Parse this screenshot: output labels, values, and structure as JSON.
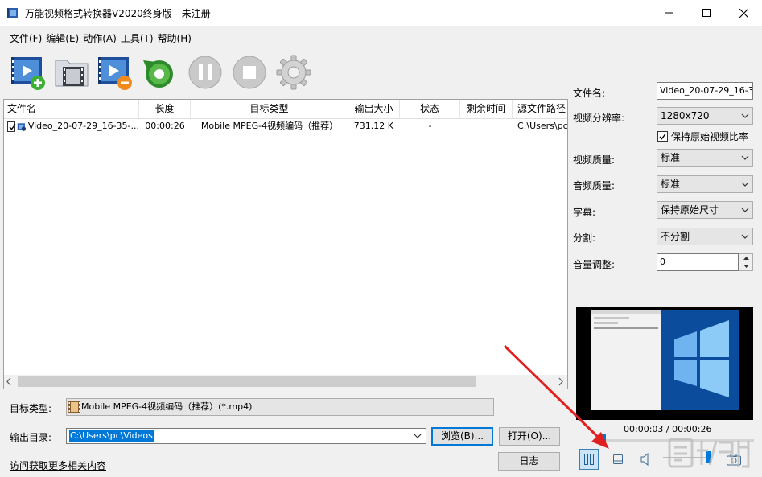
{
  "window": {
    "title": "万能视频格式转换器V2020终身版 - 未注册",
    "controls": [
      "minimize-icon",
      "maximize-icon",
      "close-icon"
    ]
  },
  "menu": [
    "文件(F)",
    "编辑(E)",
    "动作(A)",
    "工具(T)",
    "帮助(H)"
  ],
  "toolbar": {
    "buttons": [
      "add-video-icon",
      "add-folder-icon",
      "remove-video-icon",
      "convert-icon",
      "pause-icon",
      "stop-icon",
      "settings-icon"
    ]
  },
  "file_list": {
    "columns": [
      "文件名",
      "长度",
      "目标类型",
      "输出大小",
      "状态",
      "剩余时间",
      "源文件路径"
    ],
    "rows": [
      {
        "checked": true,
        "name": "Video_20-07-29_16-35-...",
        "length": "00:00:26",
        "target": "Mobile MPEG-4视频编码（推荐）",
        "size": "731.12 K",
        "status": "-",
        "remaining": "",
        "path": "C:\\Users\\pc"
      }
    ]
  },
  "bottom": {
    "target_label": "目标类型:",
    "target_value": "Mobile MPEG-4视频编码（推荐）(*.mp4)",
    "output_label": "输出目录:",
    "output_value": "C:\\Users\\pc\\Videos",
    "browse_button": "浏览(B)...",
    "open_button": "打开(O)...",
    "log_button": "日志",
    "link": "访问获取更多相关内容"
  },
  "properties": {
    "filename_label": "文件名:",
    "filename_value": "Video_20-07-29_16-35-",
    "resolution_label": "视频分辨率:",
    "resolution_value": "1280x720",
    "keep_ratio_label": "保持原始视频比率",
    "keep_ratio_checked": true,
    "video_quality_label": "视频质量:",
    "video_quality_value": "标准",
    "audio_quality_label": "音频质量:",
    "audio_quality_value": "标准",
    "subtitle_label": "字幕:",
    "subtitle_value": "保持原始尺寸",
    "split_label": "分割:",
    "split_value": "不分割",
    "volume_label": "音量调整:",
    "volume_value": "0"
  },
  "player": {
    "time": "00:00:03 / 00:00:26",
    "progress_fraction": 0.115,
    "volume_fraction": 0.9,
    "controls": [
      "pause-icon",
      "stop-icon",
      "volume-icon",
      "snapshot-icon"
    ]
  },
  "colors": {
    "accent": "#0078d7",
    "annotation_arrow": "#e02020"
  },
  "watermark": "下载吧"
}
